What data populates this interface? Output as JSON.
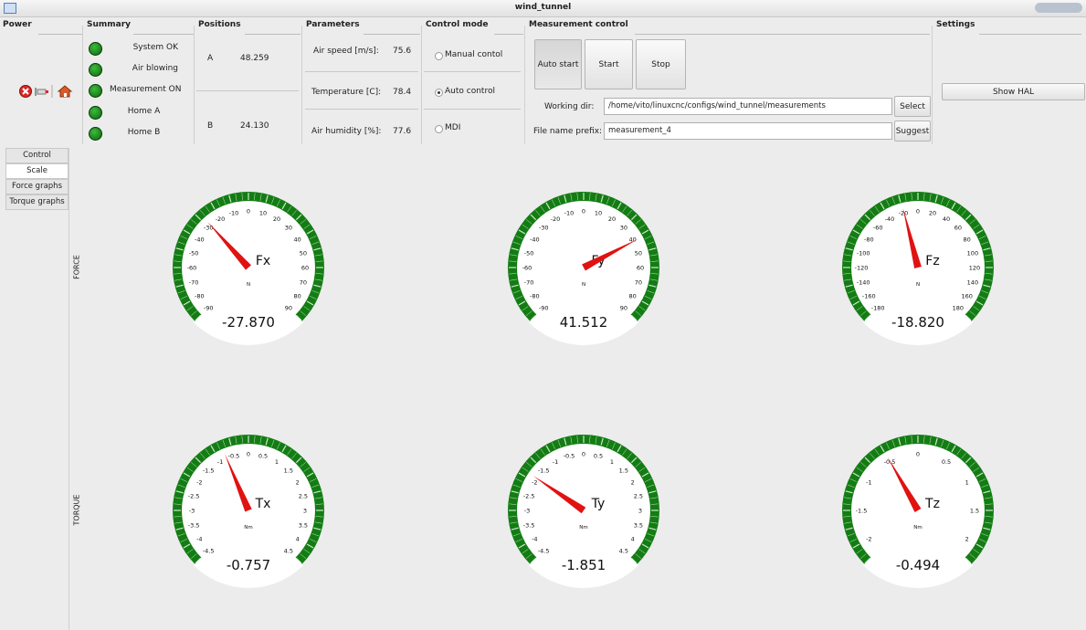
{
  "window": {
    "title": "wind_tunnel"
  },
  "power": {
    "title": "Power"
  },
  "summary": {
    "title": "Summary",
    "items": [
      {
        "label": "System OK"
      },
      {
        "label": "Air blowing"
      },
      {
        "label": "Measurement ON"
      },
      {
        "label": "Home A"
      },
      {
        "label": "Home B"
      }
    ]
  },
  "positions": {
    "title": "Positions",
    "a_label": "A",
    "a_value": "48.259",
    "b_label": "B",
    "b_value": "24.130"
  },
  "parameters": {
    "title": "Parameters",
    "rows": [
      {
        "label": "Air speed [m/s]:",
        "value": "75.6"
      },
      {
        "label": "Temperature [C]:",
        "value": "78.4"
      },
      {
        "label": "Air humidity [%]:",
        "value": "77.6"
      }
    ]
  },
  "control_mode": {
    "title": "Control mode",
    "options": [
      {
        "label": "Manual contol",
        "selected": false
      },
      {
        "label": "Auto control",
        "selected": true
      },
      {
        "label": "MDI",
        "selected": false
      }
    ]
  },
  "measurement_control": {
    "title": "Measurement control",
    "auto_start": "Auto start",
    "start": "Start",
    "stop": "Stop",
    "working_dir_label": "Working dir:",
    "working_dir_value": "/home/vito/linuxcnc/configs/wind_tunnel/measurements",
    "select": "Select",
    "prefix_label": "File name prefix:",
    "prefix_value": "measurement_4",
    "suggest": "Suggest"
  },
  "settings": {
    "title": "Settings",
    "show_hal": "Show HAL"
  },
  "side_tabs": [
    {
      "label": "Control",
      "active": false
    },
    {
      "label": "Scale",
      "active": true
    },
    {
      "label": "Force graphs",
      "active": false
    },
    {
      "label": "Torque graphs",
      "active": false
    }
  ],
  "group_labels": {
    "force": "FORCE",
    "torque": "TORQUE"
  },
  "gauges": [
    {
      "name": "Fx",
      "unit": "N",
      "value": -27.87,
      "display": "-27.870",
      "min": -90,
      "max": 90,
      "ticks": [
        "-90",
        "-80",
        "-70",
        "-60",
        "-50",
        "-40",
        "-30",
        "-20",
        "-10",
        "0",
        "10",
        "20",
        "30",
        "40",
        "50",
        "60",
        "70",
        "80",
        "90"
      ]
    },
    {
      "name": "Fy",
      "unit": "N",
      "value": 41.512,
      "display": "41.512",
      "min": -90,
      "max": 90,
      "ticks": [
        "-90",
        "-80",
        "-70",
        "-60",
        "-50",
        "-40",
        "-30",
        "-20",
        "-10",
        "0",
        "10",
        "20",
        "30",
        "40",
        "50",
        "60",
        "70",
        "80",
        "90"
      ]
    },
    {
      "name": "Fz",
      "unit": "N",
      "value": -18.82,
      "display": "-18.820",
      "min": -180,
      "max": 180,
      "ticks": [
        "-180",
        "-160",
        "-140",
        "-120",
        "-100",
        "-80",
        "-60",
        "-40",
        "-20",
        "0",
        "20",
        "40",
        "60",
        "80",
        "100",
        "120",
        "140",
        "160",
        "180"
      ]
    },
    {
      "name": "Tx",
      "unit": "Nm",
      "value": -0.757,
      "display": "-0.757",
      "min": -4.5,
      "max": 4.5,
      "ticks": [
        "-4.5",
        "-4",
        "-3.5",
        "-3",
        "-2.5",
        "-2",
        "-1.5",
        "-1",
        "-0.5",
        "0",
        "0.5",
        "1",
        "1.5",
        "2",
        "2.5",
        "3",
        "3.5",
        "4",
        "4.5"
      ]
    },
    {
      "name": "Ty",
      "unit": "Nm",
      "value": -1.851,
      "display": "-1.851",
      "min": -4.5,
      "max": 4.5,
      "ticks": [
        "-4.5",
        "-4",
        "-3.5",
        "-3",
        "-2.5",
        "-2",
        "-1.5",
        "-1",
        "-0.5",
        "0",
        "0.5",
        "1",
        "1.5",
        "2",
        "2.5",
        "3",
        "3.5",
        "4",
        "4.5"
      ]
    },
    {
      "name": "Tz",
      "unit": "Nm",
      "value": -0.494,
      "display": "-0.494",
      "min": -2.25,
      "max": 2.25,
      "ticks": [
        "-2",
        "-1.5",
        "-1",
        "-0.5",
        "0",
        "0.5",
        "1",
        "1.5",
        "2"
      ],
      "tick_values": [
        -2,
        -1.5,
        -1,
        -0.5,
        0,
        0.5,
        1,
        1.5,
        2
      ]
    }
  ],
  "colors": {
    "gauge_ring": "#137d13",
    "needle": "#e11212"
  }
}
